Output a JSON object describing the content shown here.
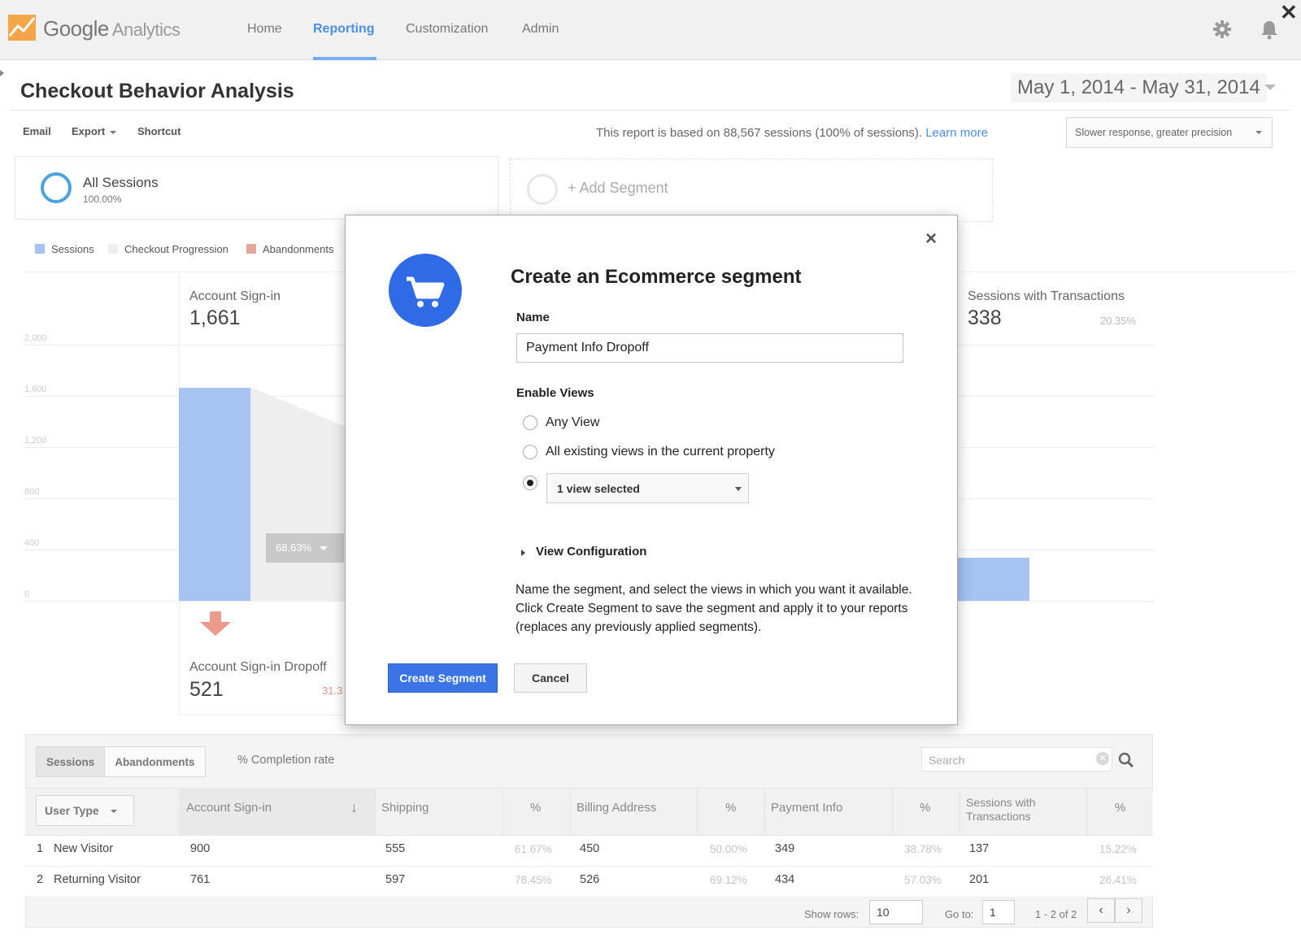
{
  "header": {
    "logo_brand": "Google",
    "logo_product": "Analytics",
    "nav": [
      {
        "label": "Home",
        "active": false
      },
      {
        "label": "Reporting",
        "active": true
      },
      {
        "label": "Customization",
        "active": false
      },
      {
        "label": "Admin",
        "active": false
      }
    ],
    "icons": [
      "gear-icon",
      "bell-icon",
      "close-icon"
    ],
    "close_glyph": "✕"
  },
  "report": {
    "title": "Checkout Behavior Analysis",
    "date_range": "May 1, 2014 - May 31, 2014",
    "toolbar": {
      "email": "Email",
      "export": "Export",
      "shortcut": "Shortcut"
    },
    "note": "This report is based on 88,567 sessions (100% of sessions).",
    "learn_more": "Learn more",
    "precision": "Slower response, greater precision"
  },
  "segments": {
    "active": {
      "name": "All Sessions",
      "pct": "100.00%"
    },
    "add_label": "+ Add Segment"
  },
  "legend": [
    {
      "label": "Sessions",
      "color": "#a6c3f1"
    },
    {
      "label": "Checkout Progression",
      "color": "#eeeeee"
    },
    {
      "label": "Abandonments",
      "color": "#e8a69b"
    }
  ],
  "chart_data": {
    "type": "bar",
    "ylim": [
      0,
      2000
    ],
    "yticks": [
      "2,000",
      "1,600",
      "1,200",
      "800",
      "400",
      "0"
    ],
    "stages": [
      {
        "label": "Account Sign-in",
        "value": "1,661",
        "sessions": 1661
      },
      {
        "label": "Sessions with Transactions",
        "value": "338",
        "pct": "20.35%",
        "sessions": 338
      }
    ],
    "conversion_badge": "68.63%",
    "dropoff": {
      "label": "Account Sign-in Dropoff",
      "value": "521",
      "pct": "31.3"
    }
  },
  "table": {
    "tabs": [
      {
        "label": "Sessions",
        "active": true
      },
      {
        "label": "Abandonments",
        "active": false
      }
    ],
    "completion_label": "% Completion rate",
    "search_placeholder": "Search",
    "clear_glyph": "✕",
    "dimension": "User Type",
    "columns": [
      "Account Sign-in",
      "Shipping",
      "%",
      "Billing Address",
      "%",
      "Payment Info",
      "%",
      "Sessions with Transactions",
      "%"
    ],
    "sessions_with_transactions_line1": "Sessions with",
    "sessions_with_transactions_line2": "Transactions",
    "sort_glyph": "↓",
    "rows": [
      {
        "idx": "1",
        "type": "New Visitor",
        "signin": "900",
        "shipping": "555",
        "ship_pct": "61.67%",
        "billing": "450",
        "bill_pct": "50.00%",
        "payment": "349",
        "pay_pct": "38.78%",
        "trans": "137",
        "trans_pct": "15.22%"
      },
      {
        "idx": "2",
        "type": "Returning Visitor",
        "signin": "761",
        "shipping": "597",
        "ship_pct": "78.45%",
        "billing": "526",
        "bill_pct": "69.12%",
        "payment": "434",
        "pay_pct": "57.03%",
        "trans": "201",
        "trans_pct": "26.41%"
      }
    ],
    "show_rows_label": "Show rows:",
    "show_rows_value": "10",
    "goto_label": "Go to:",
    "goto_value": "1",
    "range": "1 - 2 of 2",
    "prev_glyph": "‹",
    "next_glyph": "›"
  },
  "modal": {
    "close_glyph": "×",
    "title": "Create an Ecommerce segment",
    "name_label": "Name",
    "name_value": "Payment Info Dropoff",
    "views_label": "Enable Views",
    "radio_any": "Any View",
    "radio_existing": "All existing views in the current property",
    "view_select": "1 view selected",
    "config_label": "View Configuration",
    "description": "Name the segment, and select the views in which you want it available. Click Create Segment to save the segment and apply it to your reports (replaces any previously applied segments).",
    "create_button": "Create Segment",
    "cancel_button": "Cancel"
  }
}
